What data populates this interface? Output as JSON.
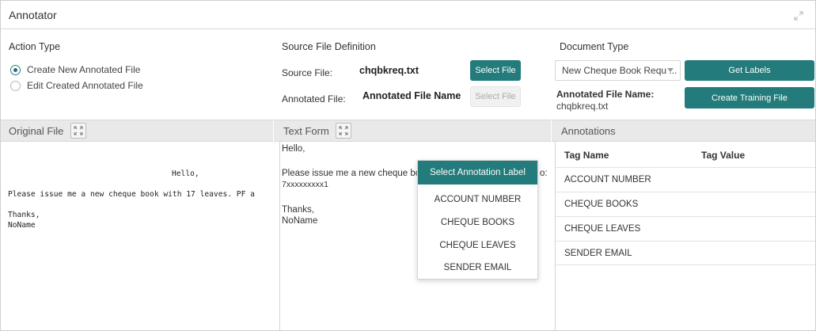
{
  "window": {
    "title": "Annotator",
    "expand_icon": "expand-arrows-icon"
  },
  "action_type": {
    "heading": "Action Type",
    "options": [
      {
        "label": "Create New Annotated File",
        "checked": true
      },
      {
        "label": "Edit Created Annotated File",
        "checked": false
      }
    ]
  },
  "source_definition": {
    "heading": "Source File Definition",
    "source_file_label": "Source File:",
    "source_file_value": "chqbkreq.txt",
    "select_file_button": "Select File",
    "annotated_file_label": "Annotated File:",
    "annotated_file_value": "Annotated File Name",
    "select_file_disabled_button": "Select File"
  },
  "document_type": {
    "heading": "Document Type",
    "selected": "New Cheque Book Requ ...",
    "get_labels_button": "Get Labels",
    "annotated_name_label": "Annotated File Name:",
    "annotated_name_value": "chqbkreq.txt",
    "create_training_button": "Create Training File"
  },
  "panels": {
    "original_file": "Original File",
    "text_form": "Text Form",
    "annotations": "Annotations"
  },
  "original_file_lines": [
    "Hello,",
    "Please issue me a new cheque book with 17 leaves. PF a",
    "Thanks,",
    "NoName"
  ],
  "text_form": {
    "greeting": "Hello,",
    "line1": "Please issue me a new cheque boo",
    "line1_tail": "o:",
    "line2": "7xxxxxxxxx1",
    "thanks": "Thanks,",
    "name": "NoName"
  },
  "annotations_table": {
    "headers": [
      "Tag Name",
      "Tag Value"
    ],
    "rows": [
      {
        "tag": "ACCOUNT NUMBER",
        "value": ""
      },
      {
        "tag": "CHEQUE BOOKS",
        "value": ""
      },
      {
        "tag": "CHEQUE LEAVES",
        "value": ""
      },
      {
        "tag": "SENDER EMAIL",
        "value": ""
      }
    ]
  },
  "popup": {
    "title": "Select Annotation Label",
    "items": [
      "ACCOUNT NUMBER",
      "CHEQUE BOOKS",
      "CHEQUE LEAVES",
      "SENDER EMAIL"
    ]
  },
  "colors": {
    "accent": "#237b7b",
    "panel_bar": "#e9e9e9"
  }
}
